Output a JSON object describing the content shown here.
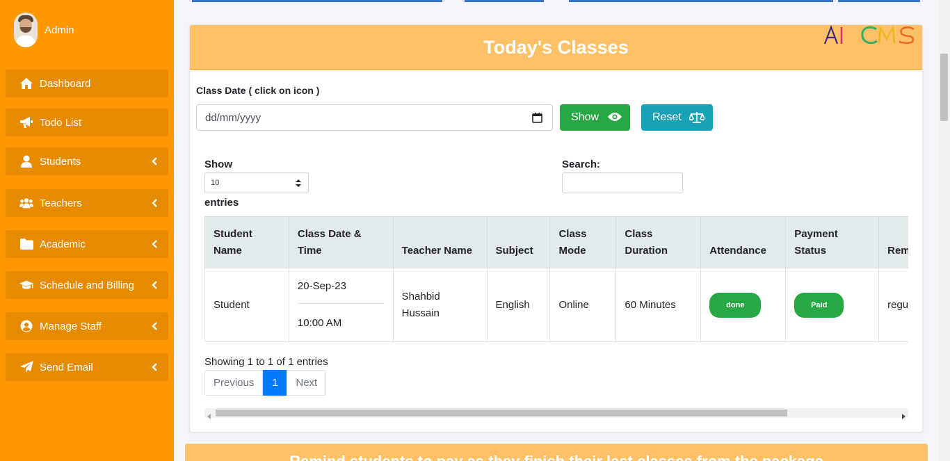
{
  "user": {
    "name": "Admin"
  },
  "sidebar": {
    "items": [
      {
        "label": "Dashboard",
        "icon": "home-icon",
        "expandable": false
      },
      {
        "label": "Todo List",
        "icon": "megaphone-icon",
        "expandable": false
      },
      {
        "label": "Students",
        "icon": "user-icon",
        "expandable": true
      },
      {
        "label": "Teachers",
        "icon": "users-icon",
        "expandable": true
      },
      {
        "label": "Academic",
        "icon": "folder-icon",
        "expandable": true
      },
      {
        "label": "Schedule and Billing",
        "icon": "graduation-cap-icon",
        "expandable": true
      },
      {
        "label": "Manage Staff",
        "icon": "user-circle-icon",
        "expandable": true
      },
      {
        "label": "Send Email",
        "icon": "paper-plane-icon",
        "expandable": true
      }
    ]
  },
  "card": {
    "title": "Today's Classes",
    "logo_text": "AI CMS",
    "date_label": "Class Date ( click on icon )",
    "date_placeholder": "dd/mm/yyyy",
    "show_button": "Show",
    "reset_button": "Reset"
  },
  "table_controls": {
    "show_label": "Show",
    "page_length": "10",
    "entries_label": "entries",
    "search_label": "Search:"
  },
  "table": {
    "headers": [
      "Student Name",
      "Class Date & Time",
      "Teacher Name",
      "Subject",
      "Class Mode",
      "Class Duration",
      "Attendance",
      "Payment Status",
      "Rem"
    ],
    "rows": [
      {
        "student": "Student",
        "date": "20-Sep-23",
        "time": "10:00 AM",
        "teacher": "Shahbid Hussain",
        "subject": "English",
        "mode": "Online",
        "duration": "60 Minutes",
        "attendance": "done",
        "payment": "Paid",
        "remarks": "regu"
      }
    ]
  },
  "pagination": {
    "info": "Showing 1 to 1 of 1 entries",
    "previous": "Previous",
    "current": "1",
    "next": "Next"
  },
  "card2": {
    "title": "Remind students to pay as they finish their last classes from the package"
  },
  "colors": {
    "sidebar": "#ff9800",
    "header": "#ffc168",
    "success": "#28a745",
    "info": "#17a2b8",
    "primary": "#007bff"
  }
}
